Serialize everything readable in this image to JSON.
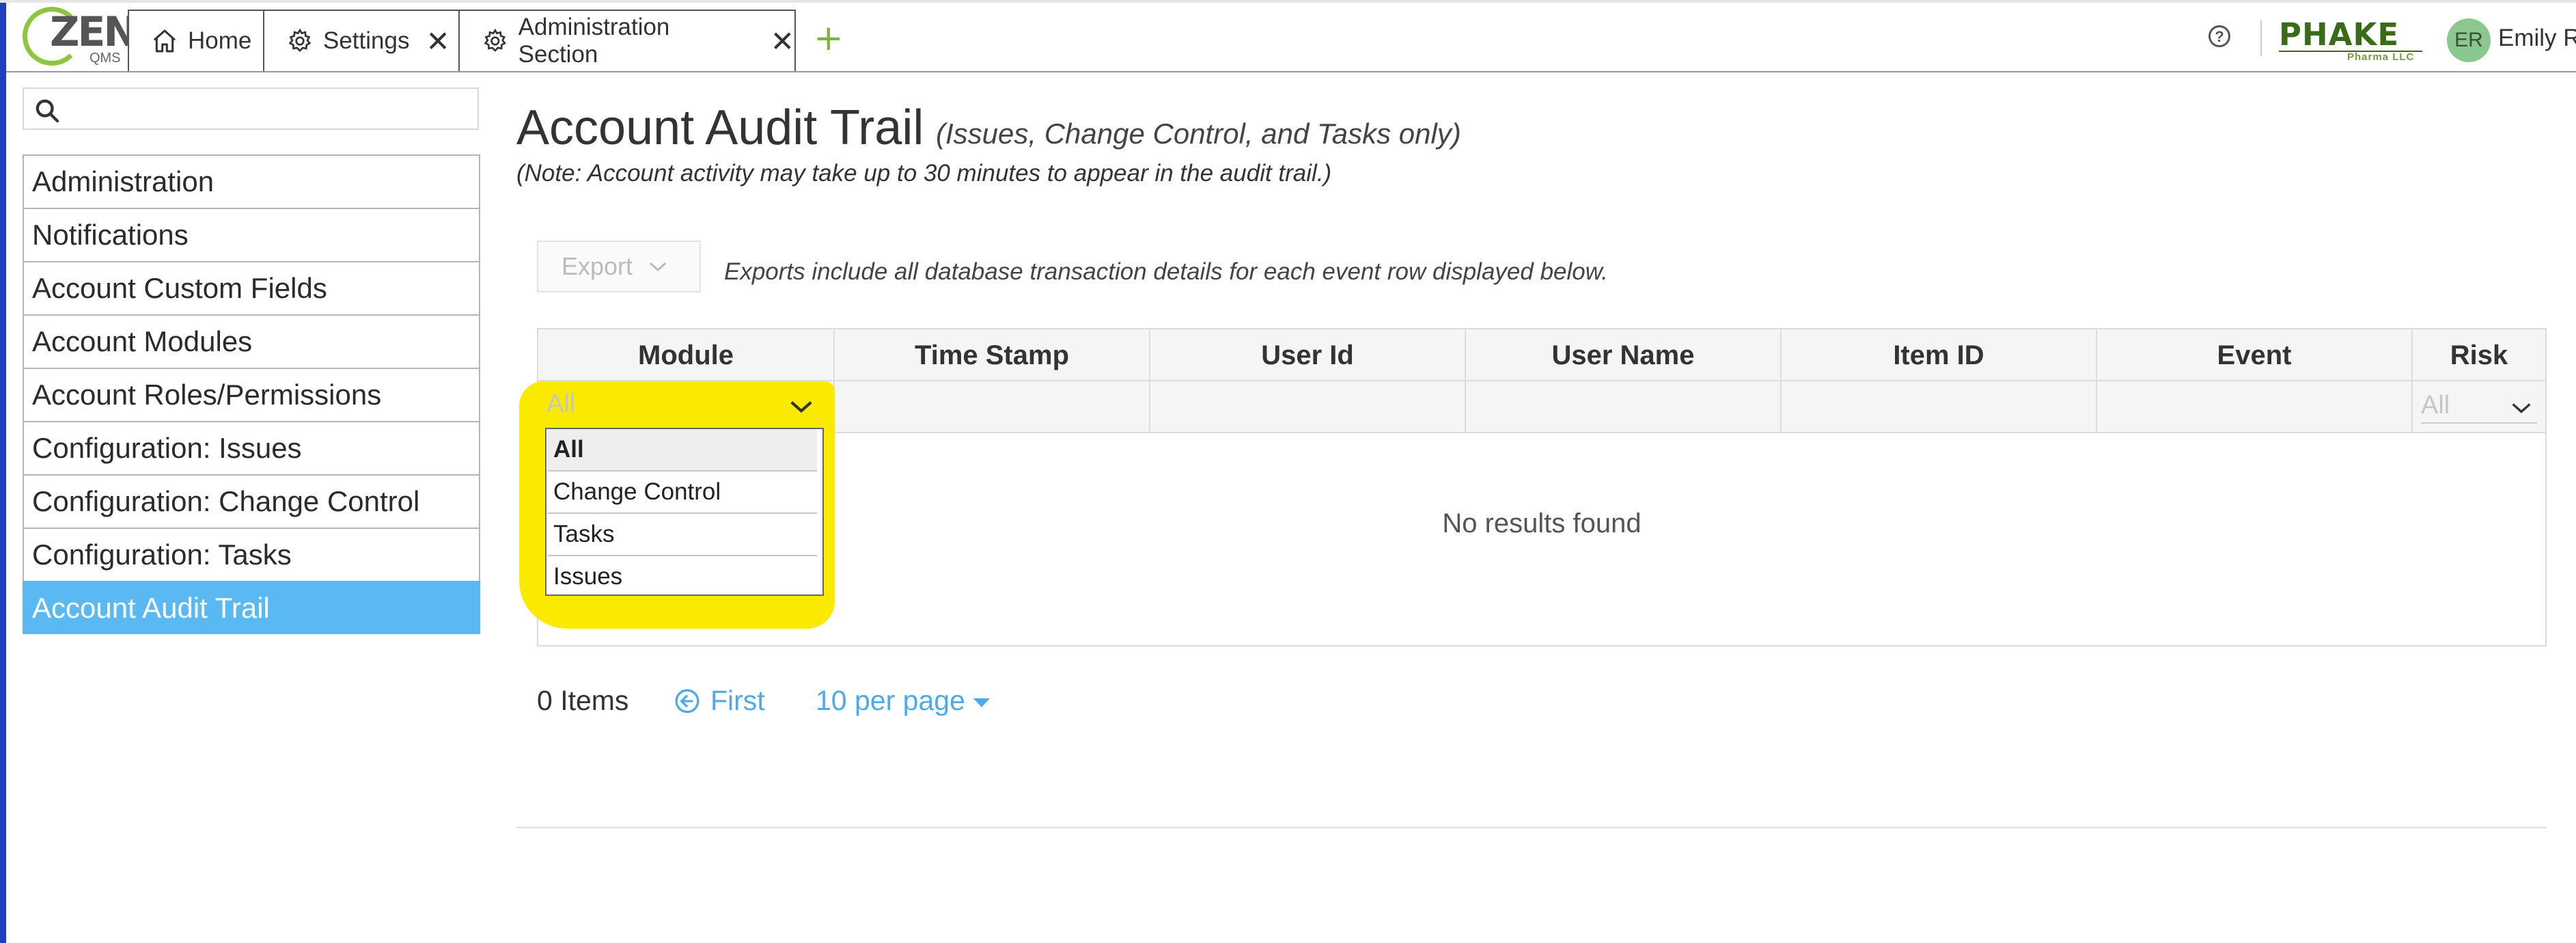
{
  "app": {
    "logo_text": "ZEN",
    "logo_sub": "QMS",
    "tabs": [
      {
        "label": "Home",
        "icon": "home-icon"
      },
      {
        "label": "Settings",
        "icon": "gear-icon",
        "close": "✕"
      },
      {
        "label": "Administration Section",
        "icon": "gear-icon",
        "close": "✕"
      }
    ],
    "add_tab": "+",
    "help_glyph": "?",
    "brand": {
      "name": "PHAKE",
      "sub": "Pharma LLC"
    },
    "user": {
      "initials": "ER",
      "name": "Emily R"
    }
  },
  "sidebar": {
    "search": {
      "value": "",
      "placeholder": "",
      "icon": "search-icon"
    },
    "items": [
      {
        "label": "Administration",
        "active": false
      },
      {
        "label": "Notifications",
        "active": false
      },
      {
        "label": "Account Custom Fields",
        "active": false
      },
      {
        "label": "Account Modules",
        "active": false
      },
      {
        "label": "Account Roles/Permissions",
        "active": false
      },
      {
        "label": "Configuration: Issues",
        "active": false
      },
      {
        "label": "Configuration: Change Control",
        "active": false
      },
      {
        "label": "Configuration: Tasks",
        "active": false
      },
      {
        "label": "Account Audit Trail",
        "active": true
      }
    ]
  },
  "main": {
    "title": "Account Audit Trail",
    "subtitle": "(Issues, Change Control, and Tasks only)",
    "note": "(Note: Account activity may take up to 30 minutes to appear in the audit trail.)",
    "export": {
      "label": "Export",
      "note": "Exports include all database transaction details for each event row displayed below."
    },
    "grid": {
      "columns": [
        "Module",
        "Time Stamp",
        "User Id",
        "User Name",
        "Item ID",
        "Event",
        "Risk"
      ],
      "module_filter": {
        "value": "All",
        "options": [
          "All",
          "Change Control",
          "Tasks",
          "Issues"
        ],
        "selected": "All"
      },
      "risk_filter": {
        "value": "All"
      },
      "empty_message": "No results found"
    },
    "pager": {
      "count": "0 Items",
      "first": "First",
      "page_size": "10 per page"
    }
  },
  "colors": {
    "accent": "#5ab8f3",
    "link": "#4eaaec",
    "annotation_highlight": "#faea00",
    "brand_green": "#3a6b19",
    "add_tab": "#7cb342"
  }
}
